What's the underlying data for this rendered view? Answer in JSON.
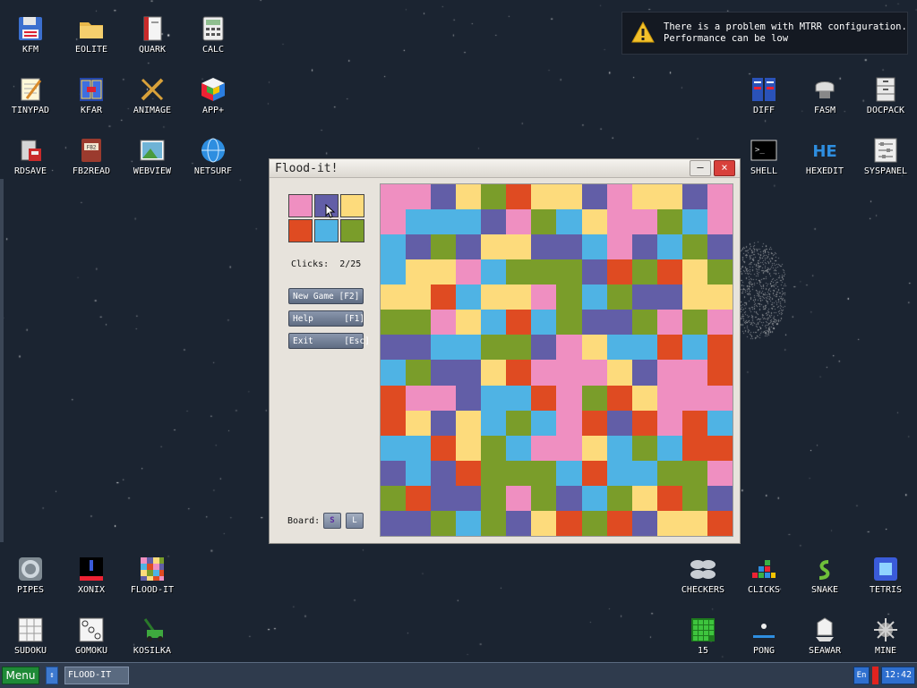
{
  "desktop": {
    "icons_left": [
      {
        "label": "KFM",
        "icon": "floppy-disk-icon"
      },
      {
        "label": "EOLITE",
        "icon": "folder-icon"
      },
      {
        "label": "QUARK",
        "icon": "book-icon"
      },
      {
        "label": "CALC",
        "icon": "calculator-icon"
      },
      {
        "label": "TINYPAD",
        "icon": "notepad-icon"
      },
      {
        "label": "KFAR",
        "icon": "file-manager-icon"
      },
      {
        "label": "ANIMAGE",
        "icon": "paint-tools-icon"
      },
      {
        "label": "APP+",
        "icon": "rubik-cube-icon"
      },
      {
        "label": "RDSAVE",
        "icon": "save-ramdisk-icon"
      },
      {
        "label": "FB2READ",
        "icon": "ebook-icon"
      },
      {
        "label": "WEBVIEW",
        "icon": "picture-icon"
      },
      {
        "label": "NETSURF",
        "icon": "globe-icon"
      }
    ],
    "icons_right": [
      {
        "label": "DIFF",
        "icon": "diff-icon"
      },
      {
        "label": "FASM",
        "icon": "assembler-icon"
      },
      {
        "label": "DOCPACK",
        "icon": "cabinet-icon"
      },
      {
        "label": "SHELL",
        "icon": "terminal-icon"
      },
      {
        "label": "HEXEDIT",
        "icon": "hex-editor-icon"
      },
      {
        "label": "SYSPANEL",
        "icon": "control-panel-icon"
      }
    ],
    "icons_bottom_left": [
      {
        "label": "PIPES",
        "icon": "pipes-icon"
      },
      {
        "label": "XONIX",
        "icon": "xonix-icon"
      },
      {
        "label": "FLOOD-IT",
        "icon": "flood-it-icon"
      },
      {
        "label": "SUDOKU",
        "icon": "sudoku-icon"
      },
      {
        "label": "GOMOKU",
        "icon": "gomoku-icon"
      },
      {
        "label": "KOSILKA",
        "icon": "lawnmower-icon"
      }
    ],
    "icons_bottom_right": [
      {
        "label": "CHECKERS",
        "icon": "checkers-icon"
      },
      {
        "label": "CLICKS",
        "icon": "clicks-icon"
      },
      {
        "label": "SNAKE",
        "icon": "snake-icon"
      },
      {
        "label": "TETRIS",
        "icon": "tetris-icon"
      },
      {
        "label": "15",
        "icon": "fifteen-puzzle-icon"
      },
      {
        "label": "PONG",
        "icon": "pong-icon"
      },
      {
        "label": "SEAWAR",
        "icon": "sea-war-icon"
      },
      {
        "label": "MINE",
        "icon": "mine-icon"
      }
    ]
  },
  "notification": {
    "line1": "There is a problem with MTRR configuration.",
    "line2": "Performance can be low",
    "icon": "warning-icon"
  },
  "window": {
    "title": "Flood-it!",
    "minimize_label": "–",
    "close_label": "×",
    "clicks_label": "Clicks:",
    "clicks_value": "2/25",
    "buttons": {
      "new_game": "New Game [F2]",
      "help": "Help      [F1]",
      "exit": "Exit      [Esc]"
    },
    "board_label": "Board:",
    "board_small": "S",
    "board_large": "L"
  },
  "colors": {
    "pink": "#ef8fc1",
    "purple": "#625ea7",
    "yellow": "#fddb7c",
    "red": "#df4b22",
    "blue": "#4fb3e4",
    "green": "#7a9d2a"
  },
  "palette_order": [
    "pink",
    "purple",
    "yellow",
    "red",
    "blue",
    "green"
  ],
  "board": {
    "size": 14,
    "rows": [
      "ppPygrYyPpyyPp",
      "pbbbPpgbyppgbp",
      "bPgPyyPPbpPbgP",
      "byypbgggPrgrYg",
      "yyrbyypgbgPPy",
      "ggpybrbgPPgpgp",
      "PPbbggPpybbrbr",
      "bgPPyrpppyPppr",
      "rppPbbrpgryppp",
      "ryPybgbprPrprb",
      "bbrygbppybgbrr",
      "PbPrgggbrbbggp",
      "grPPgpgPbgyrgP",
      "PPgbgPyrgrPyyr"
    ]
  },
  "taskbar": {
    "menu_label": "Menu",
    "arrows_label": "↕",
    "task_label": "FLOOD-IT",
    "lang_label": "En",
    "clock": "12:42"
  }
}
